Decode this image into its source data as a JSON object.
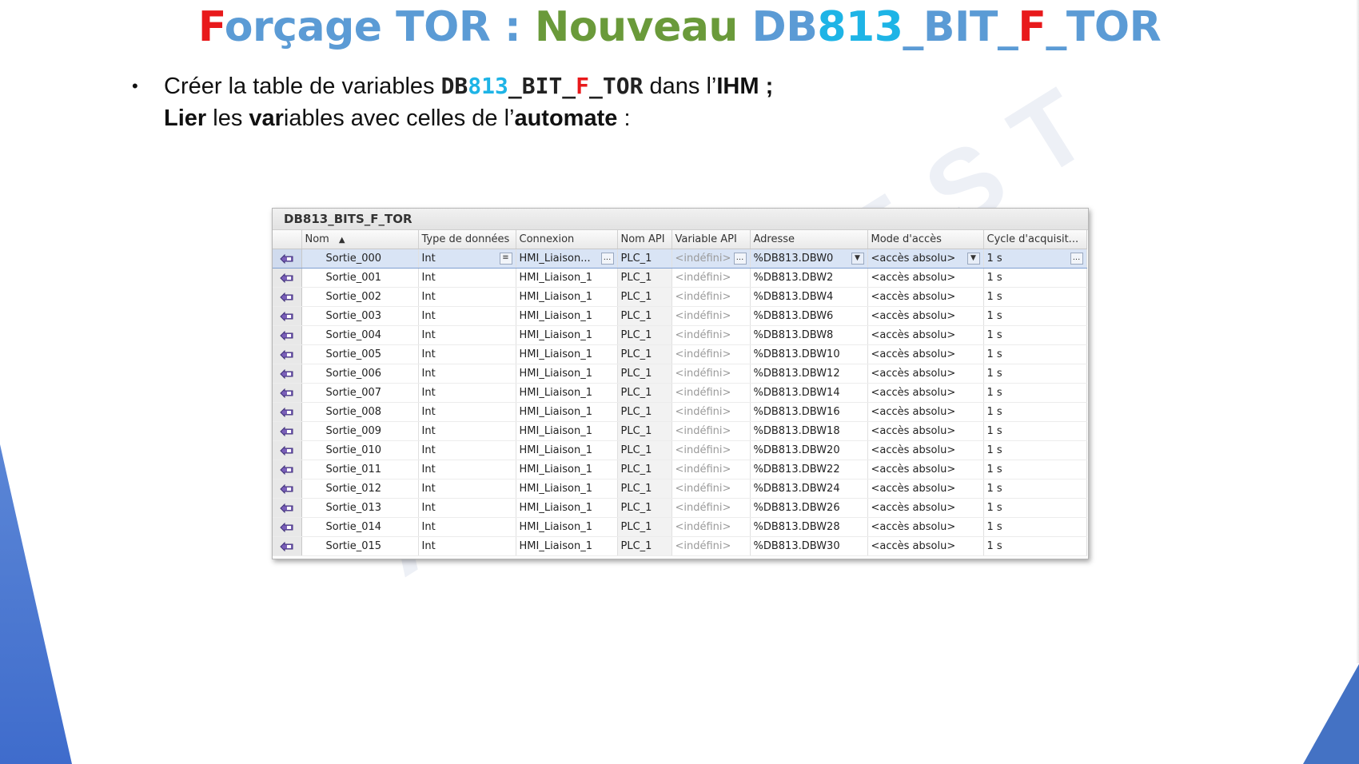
{
  "title": {
    "p1": "F",
    "p2": "orçage TOR",
    "p3": " : ",
    "p4": "Nouveau",
    "p5": " DB",
    "p6": "813",
    "p7": "_BIT_",
    "p8": "F",
    "p9": "_TOR"
  },
  "bullet": {
    "dot": "•",
    "l1a": "Créer la table de variables ",
    "db_a": "DB",
    "db_b": "813",
    "db_c": "_BIT_",
    "db_d": "F",
    "db_e": "_TOR",
    "l1b": " dans l’",
    "l1c": "IHM ;",
    "l2a": "Lier",
    "l2b": " les ",
    "l2c": "var",
    "l2d": "iables avec celles de l’",
    "l2e": "automate",
    "l2f": " :"
  },
  "watermark": "AEI OUEST",
  "table": {
    "caption": "DB813_BITS_F_TOR",
    "columns": {
      "nom": "Nom",
      "type": "Type de données",
      "connexion": "Connexion",
      "nom_api": "Nom API",
      "variable_api": "Variable API",
      "adresse": "Adresse",
      "mode": "Mode d'accès",
      "cycle": "Cycle d'acquisit..."
    },
    "row0": {
      "nom": "Sortie_000",
      "type": "Int",
      "connexion": "HMI_Liaison...",
      "nom_api": "PLC_1",
      "variable_api": "<indéfini>",
      "adresse": "%DB813.DBW0",
      "mode": "<accès absolu>",
      "cycle": "1 s"
    },
    "rows": [
      {
        "nom": "Sortie_001",
        "type": "Int",
        "connexion": "HMI_Liaison_1",
        "nom_api": "PLC_1",
        "variable_api": "<indéfini>",
        "adresse": "%DB813.DBW2",
        "mode": "<accès absolu>",
        "cycle": "1 s"
      },
      {
        "nom": "Sortie_002",
        "type": "Int",
        "connexion": "HMI_Liaison_1",
        "nom_api": "PLC_1",
        "variable_api": "<indéfini>",
        "adresse": "%DB813.DBW4",
        "mode": "<accès absolu>",
        "cycle": "1 s"
      },
      {
        "nom": "Sortie_003",
        "type": "Int",
        "connexion": "HMI_Liaison_1",
        "nom_api": "PLC_1",
        "variable_api": "<indéfini>",
        "adresse": "%DB813.DBW6",
        "mode": "<accès absolu>",
        "cycle": "1 s"
      },
      {
        "nom": "Sortie_004",
        "type": "Int",
        "connexion": "HMI_Liaison_1",
        "nom_api": "PLC_1",
        "variable_api": "<indéfini>",
        "adresse": "%DB813.DBW8",
        "mode": "<accès absolu>",
        "cycle": "1 s"
      },
      {
        "nom": "Sortie_005",
        "type": "Int",
        "connexion": "HMI_Liaison_1",
        "nom_api": "PLC_1",
        "variable_api": "<indéfini>",
        "adresse": "%DB813.DBW10",
        "mode": "<accès absolu>",
        "cycle": "1 s"
      },
      {
        "nom": "Sortie_006",
        "type": "Int",
        "connexion": "HMI_Liaison_1",
        "nom_api": "PLC_1",
        "variable_api": "<indéfini>",
        "adresse": "%DB813.DBW12",
        "mode": "<accès absolu>",
        "cycle": "1 s"
      },
      {
        "nom": "Sortie_007",
        "type": "Int",
        "connexion": "HMI_Liaison_1",
        "nom_api": "PLC_1",
        "variable_api": "<indéfini>",
        "adresse": "%DB813.DBW14",
        "mode": "<accès absolu>",
        "cycle": "1 s"
      },
      {
        "nom": "Sortie_008",
        "type": "Int",
        "connexion": "HMI_Liaison_1",
        "nom_api": "PLC_1",
        "variable_api": "<indéfini>",
        "adresse": "%DB813.DBW16",
        "mode": "<accès absolu>",
        "cycle": "1 s"
      },
      {
        "nom": "Sortie_009",
        "type": "Int",
        "connexion": "HMI_Liaison_1",
        "nom_api": "PLC_1",
        "variable_api": "<indéfini>",
        "adresse": "%DB813.DBW18",
        "mode": "<accès absolu>",
        "cycle": "1 s"
      },
      {
        "nom": "Sortie_010",
        "type": "Int",
        "connexion": "HMI_Liaison_1",
        "nom_api": "PLC_1",
        "variable_api": "<indéfini>",
        "adresse": "%DB813.DBW20",
        "mode": "<accès absolu>",
        "cycle": "1 s"
      },
      {
        "nom": "Sortie_011",
        "type": "Int",
        "connexion": "HMI_Liaison_1",
        "nom_api": "PLC_1",
        "variable_api": "<indéfini>",
        "adresse": "%DB813.DBW22",
        "mode": "<accès absolu>",
        "cycle": "1 s"
      },
      {
        "nom": "Sortie_012",
        "type": "Int",
        "connexion": "HMI_Liaison_1",
        "nom_api": "PLC_1",
        "variable_api": "<indéfini>",
        "adresse": "%DB813.DBW24",
        "mode": "<accès absolu>",
        "cycle": "1 s"
      },
      {
        "nom": "Sortie_013",
        "type": "Int",
        "connexion": "HMI_Liaison_1",
        "nom_api": "PLC_1",
        "variable_api": "<indéfini>",
        "adresse": "%DB813.DBW26",
        "mode": "<accès absolu>",
        "cycle": "1 s"
      },
      {
        "nom": "Sortie_014",
        "type": "Int",
        "connexion": "HMI_Liaison_1",
        "nom_api": "PLC_1",
        "variable_api": "<indéfini>",
        "adresse": "%DB813.DBW28",
        "mode": "<accès absolu>",
        "cycle": "1 s"
      },
      {
        "nom": "Sortie_015",
        "type": "Int",
        "connexion": "HMI_Liaison_1",
        "nom_api": "PLC_1",
        "variable_api": "<indéfini>",
        "adresse": "%DB813.DBW30",
        "mode": "<accès absolu>",
        "cycle": "1 s"
      }
    ],
    "row_icon": "hmi-tag-icon",
    "sort_icon": "sort-ascending-icon",
    "buttons": {
      "ellipsis": "...",
      "dropdown": "▼",
      "list_icon": "≡"
    }
  },
  "colors": {
    "accent_red": "#e8191b",
    "accent_blue": "#5b9bd5",
    "accent_green": "#6a9a3a",
    "accent_cyan": "#1eb4e6",
    "selected_row": "#d9e4f5",
    "corner_blue": "#4472c4"
  }
}
